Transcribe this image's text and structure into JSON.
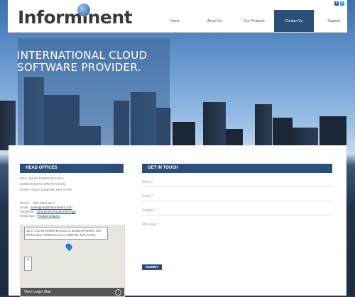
{
  "header": {
    "logo_text": "Informinent",
    "nav": [
      "Home",
      "About Us",
      "Our Products",
      "Contact Us",
      "Support"
    ],
    "social": [
      "f",
      "t"
    ]
  },
  "hero": {
    "title": "INTERNATIONAL CLOUD SOFTWARE PROVIDER."
  },
  "head_offices": {
    "heading": "HEAD OFFICES",
    "address": [
      "25-2, JALAN RADIN BAGUS 3,",
      "BANDAR BARU SRI PETALING,",
      "57000 KUALA LUMPUR, MALAYSIA"
    ],
    "phone": "Phone : +603 9054 3371",
    "email_label": "Email :",
    "email": "ssesupport@informinent.com",
    "facebook_label": "Facebook :",
    "facebook": "Informinent Facebook Page",
    "whatsapp_label": "WhatsApp :",
    "whatsapp": "Product Enquiry",
    "map_label": "25-2, JALAN RADIN BAGUS 3, BANDAR BARU SRI PETALING, 57000 KUALA LUMPUR, MALAYSIA",
    "zoom_in": "+",
    "zoom_out": "-",
    "map_link": "View Larger Map"
  },
  "get_in_touch": {
    "heading": "GET IN TOUCH",
    "fields": [
      "Name *",
      "Email *",
      "Subject *",
      "Message *"
    ],
    "submit": "SUBMIT"
  }
}
